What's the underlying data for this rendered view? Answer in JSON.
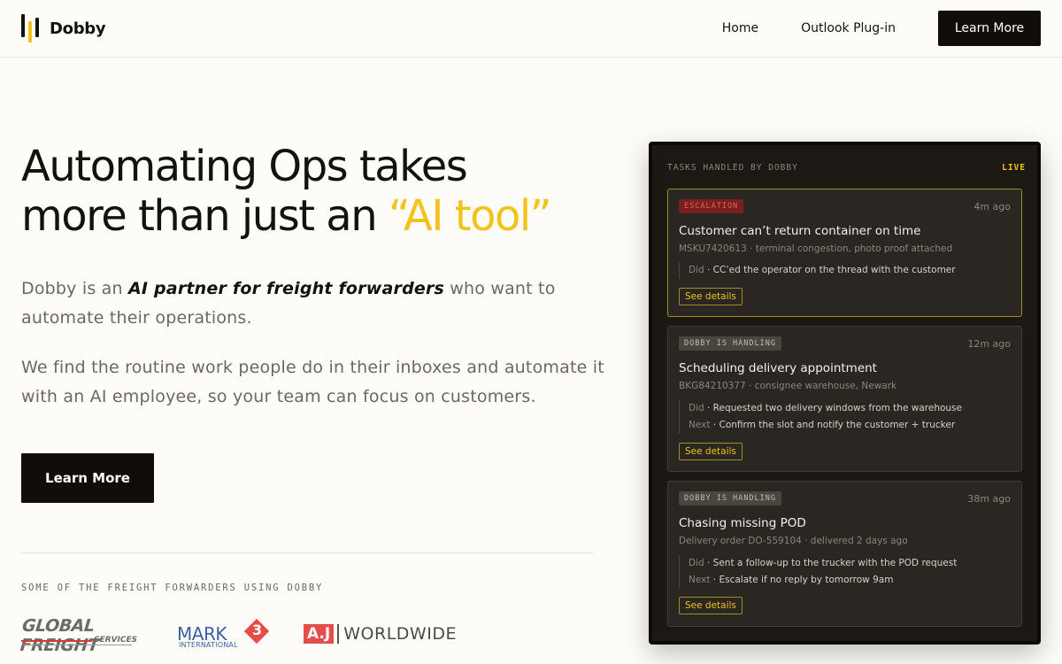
{
  "header": {
    "brand": "Dobby",
    "nav": [
      "Home",
      "Outlook Plug-in"
    ],
    "cta": "Learn More",
    "colors": {
      "brand_black": "#110d0a",
      "accent_yellow": "#f2c31c"
    }
  },
  "hero": {
    "title_line1": "Automating Ops takes",
    "title_line2_prefix": "more than just an ",
    "title_accent": "“AI tool”",
    "p1_prefix": "Dobby is an ",
    "p1_emphasis": "AI partner for freight forwarders",
    "p1_suffix": " who want to automate their operations.",
    "p2": "We find the routine work people do in their inboxes and automate it with an AI employee, so your team can focus on customers.",
    "cta": "Learn More",
    "customers_label": "SOME OF THE FREIGHT FORWARDERS USING DOBBY",
    "customer_logos": {
      "global_freight": {
        "name": "GLOBAL FREIGHT",
        "sub": "SERVICES"
      },
      "mark3": {
        "name": "MARK",
        "number": "3",
        "sub": "INTERNATIONAL"
      },
      "aj": {
        "mark": "A.J",
        "name": "WORLDWIDE"
      }
    }
  },
  "panel": {
    "title": "TASKS HANDLED BY DOBBY",
    "status": "LIVE",
    "tasks": [
      {
        "badge": "ESCALATION",
        "time": "4m ago",
        "title": "Customer can’t return container on time",
        "subtitle": "MSKU7420613 · terminal congestion, photo proof attached",
        "steps": [
          {
            "key": "Did",
            "text": " · CC’ed the operator on the thread with the customer"
          }
        ],
        "action": "See details"
      },
      {
        "badge": "DOBBY IS HANDLING",
        "time": "12m ago",
        "title": "Scheduling delivery appointment",
        "subtitle": "BKG84210377 · consignee warehouse, Newark",
        "steps": [
          {
            "key": "Did",
            "text": " · Requested two delivery windows from the warehouse"
          },
          {
            "key": "Next",
            "text": " · Confirm the slot and notify the customer + trucker"
          }
        ],
        "action": "See details"
      },
      {
        "badge": "DOBBY IS HANDLING",
        "time": "38m ago",
        "title": "Chasing missing POD",
        "subtitle": "Delivery order DO-559104 · delivered 2 days ago",
        "steps": [
          {
            "key": "Did",
            "text": " · Sent a follow-up to the trucker with the POD request"
          },
          {
            "key": "Next",
            "text": " · Escalate if no reply by tomorrow 9am"
          }
        ],
        "action": "See details"
      }
    ]
  }
}
